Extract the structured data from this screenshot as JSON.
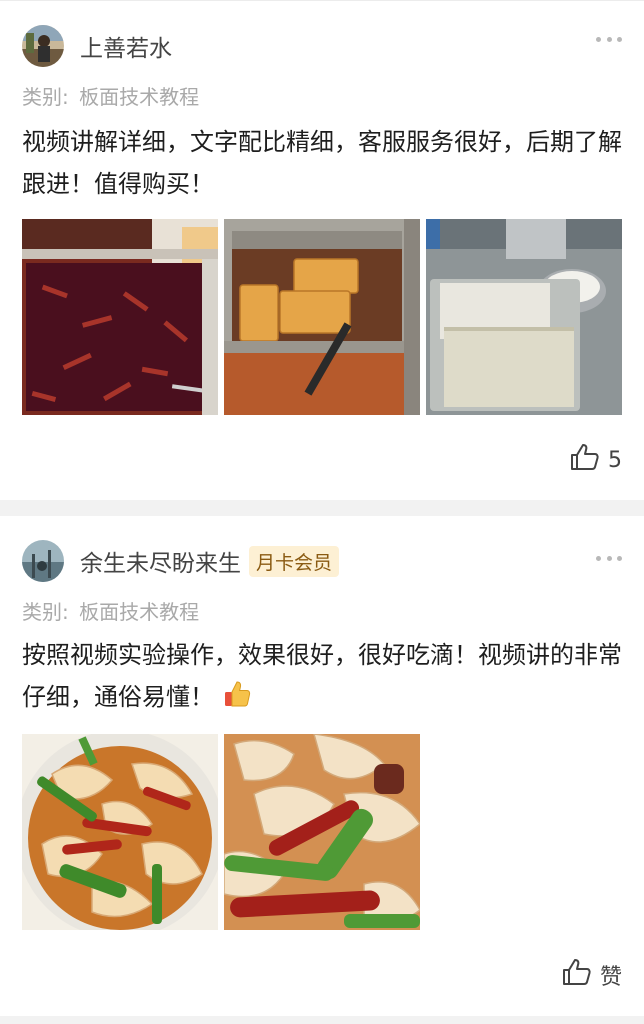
{
  "posts": [
    {
      "username": "上善若水",
      "badge": "",
      "category_label": "类别:",
      "category_value": "板面技术教程",
      "text": "视频讲解详细，文字配比精细，客服服务很好，后期了解跟进！值得购买！",
      "photos": [
        "photo-chili-oil",
        "photo-fried-tofu",
        "photo-dough-sheets"
      ],
      "like_count": "5"
    },
    {
      "username": "余生未尽盼来生",
      "badge": "月卡会员",
      "category_label": "类别:",
      "category_value": "板面技术教程",
      "text": "按照视频实验操作，效果很好，很好吃滴！视频讲的非常仔细，通俗易懂！",
      "photos": [
        "photo-noodles-bowl-1",
        "photo-noodles-bowl-2"
      ],
      "like_label": "赞"
    }
  ],
  "icons": {
    "more": "more-dots-icon",
    "like": "thumbs-up-icon",
    "emoji": "thumbs-up-emoji"
  },
  "colors": {
    "badge_bg": "#fdf0d4",
    "badge_text": "#8a5a12",
    "meta_text": "#a9a9a9"
  }
}
